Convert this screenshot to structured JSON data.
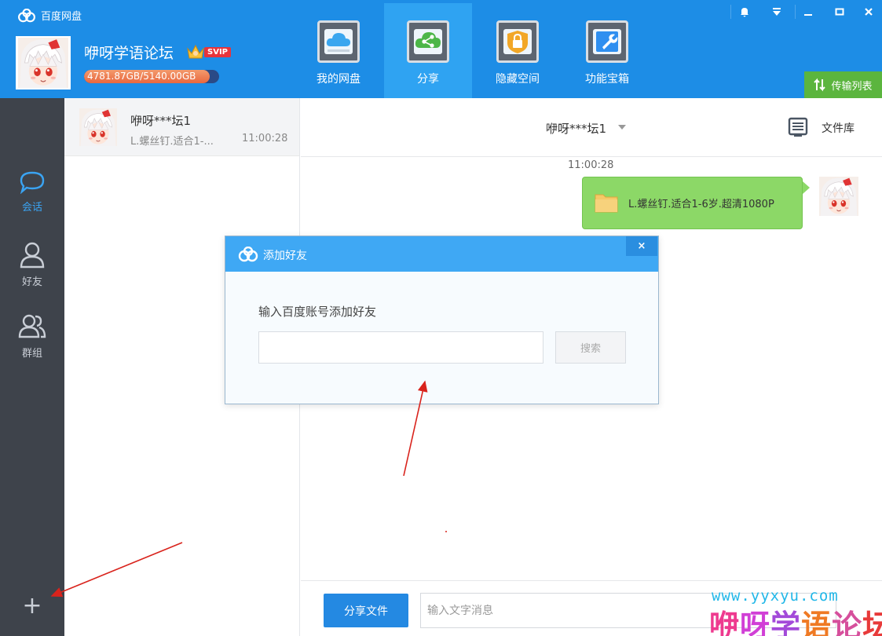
{
  "app": {
    "title": "百度网盘"
  },
  "profile": {
    "name": "咿呀学语论坛",
    "badge": "SVIP",
    "quota_text": "4781.87GB/5140.00GB",
    "quota_used_fraction": 0.93
  },
  "nav": {
    "tabs": [
      {
        "label": "我的网盘",
        "icon": "cloud-drive-icon",
        "active": false
      },
      {
        "label": "分享",
        "icon": "share-icon",
        "active": true
      },
      {
        "label": "隐藏空间",
        "icon": "lock-icon",
        "active": false
      },
      {
        "label": "功能宝箱",
        "icon": "wrench-toolbox-icon",
        "active": false
      }
    ]
  },
  "window_controls": [
    "bell-icon",
    "menu-icon",
    "minimize-icon",
    "maximize-icon",
    "close-icon"
  ],
  "transfer": {
    "label": "传输列表"
  },
  "rail": {
    "items": [
      {
        "label": "会话",
        "icon": "chat-bubble-icon",
        "active": true
      },
      {
        "label": "好友",
        "icon": "person-icon",
        "active": false
      },
      {
        "label": "群组",
        "icon": "group-icon",
        "active": false
      }
    ],
    "add_label": "+"
  },
  "conversations": [
    {
      "name": "咿呀***坛1",
      "preview": "L.螺丝钉.适合1-...",
      "time": "11:00:28"
    }
  ],
  "chat": {
    "title": "咿呀***坛1",
    "library_label": "文件库",
    "messages": [
      {
        "time": "11:00:28",
        "file_name": "L.螺丝钉.适合1-6岁.超清1080P"
      }
    ],
    "share_file_label": "分享文件",
    "input_placeholder": "输入文字消息"
  },
  "dialog": {
    "title": "添加好友",
    "close_label": "×",
    "prompt": "输入百度账号添加好友",
    "input_value": "",
    "search_label": "搜索"
  },
  "watermark": {
    "url": "www.yyxyu.com",
    "title": "咿呀学语论坛"
  },
  "colors": {
    "header_bg": "#1d8de6",
    "active_tab": "#2fa3f2",
    "rail_bg": "#3e434b",
    "bubble": "#8cd867",
    "transfer_btn": "#5bb53e",
    "annotation_arrow": "#d9231c"
  }
}
